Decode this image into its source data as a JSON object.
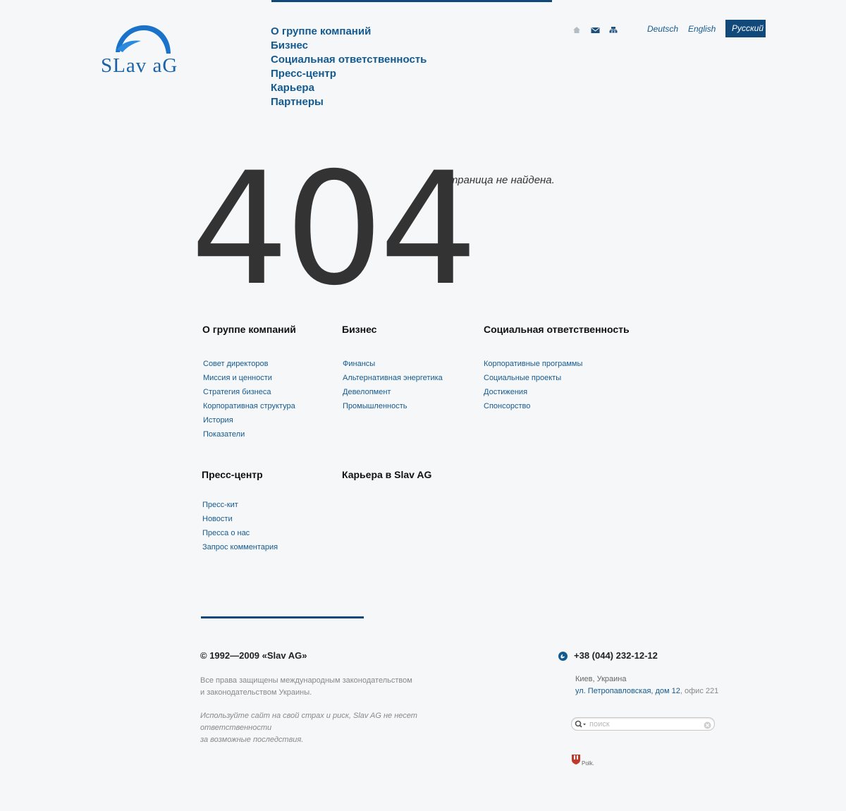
{
  "logo": {
    "text": "SLav aG"
  },
  "nav": {
    "items": [
      "О группе компаний",
      "Бизнес",
      "Социальная ответственность",
      "Пресс-центр",
      "Карьера",
      "Партнеры"
    ]
  },
  "utility": {
    "icons": [
      "home-icon",
      "mail-icon",
      "sitemap-icon"
    ]
  },
  "languages": [
    {
      "label": "Deutsch",
      "active": false
    },
    {
      "label": "English",
      "active": false
    },
    {
      "label": "Русский",
      "active": true
    }
  ],
  "error": {
    "code": "404",
    "message": "Страница не найдена."
  },
  "sitemap": [
    {
      "title": "О группе компаний",
      "links": [
        "Совет директоров",
        "Миссия и ценности",
        "Стратегия бизнеса",
        "Корпоративная структура",
        "История",
        "Показатели"
      ]
    },
    {
      "title": "Бизнес",
      "links": [
        "Финансы",
        "Альтернативная энергетика",
        "Девелопмент",
        "Промышленность"
      ]
    },
    {
      "title": "Социальная ответственность",
      "links": [
        "Корпоративные программы",
        "Социальные проекты",
        "Достижения",
        "Спонсорство"
      ]
    },
    {
      "title": "Пресс-центр",
      "links": [
        "Пресс-кит",
        "Новости",
        "Пресса о нас",
        "Запрос комментария"
      ]
    },
    {
      "title": "Карьера в Slav AG",
      "links": []
    }
  ],
  "footer": {
    "copyright": "© 1992—2009 «Slav AG»",
    "rights_line1": "Все права защищены международным законодательством",
    "rights_line2": "и законодательством Украины.",
    "disclaimer_line1": "Используйте сайт на свой страх и риск, Slav AG не несет ответственности",
    "disclaimer_line2": "за возможные последствия.",
    "phone": "+38 (044) 232-12-12",
    "city": "Киев, Украина",
    "address_link": "ул. Петропавловская, дом 12",
    "address_rest": ", офис 221",
    "search_placeholder": "поиск",
    "studio": "Polk."
  },
  "colors": {
    "accent": "#12497b",
    "link": "#135a90",
    "background": "#f6f7f9",
    "text": "#333333"
  }
}
